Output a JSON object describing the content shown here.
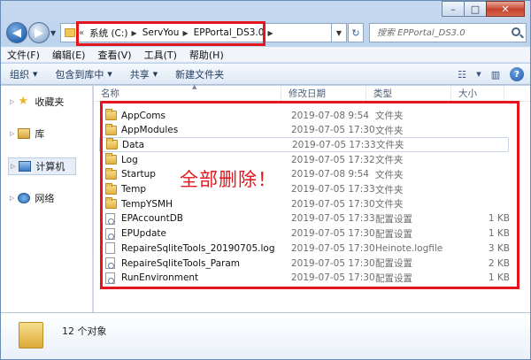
{
  "window": {
    "minimize": "–",
    "maximize": "□",
    "close": "✕"
  },
  "address": {
    "prefix": "«",
    "crumbs": [
      "系统 (C:)",
      "ServYou",
      "EPPortal_DS3.0"
    ]
  },
  "search": {
    "placeholder": "搜索 EPPortal_DS3.0"
  },
  "menu": [
    "文件(F)",
    "编辑(E)",
    "查看(V)",
    "工具(T)",
    "帮助(H)"
  ],
  "toolbar": {
    "organize": "组织",
    "include": "包含到库中",
    "share": "共享",
    "new_folder": "新建文件夹"
  },
  "navpane": {
    "favorites": "收藏夹",
    "libraries": "库",
    "computer": "计算机",
    "network": "网络"
  },
  "columns": {
    "name": "名称",
    "modified": "修改日期",
    "type": "类型",
    "size": "大小"
  },
  "files": [
    {
      "name": "AppComs",
      "date": "2019-07-08 9:54",
      "type": "文件夹",
      "size": "",
      "icon": "folder"
    },
    {
      "name": "AppModules",
      "date": "2019-07-05 17:30",
      "type": "文件夹",
      "size": "",
      "icon": "folder"
    },
    {
      "name": "Data",
      "date": "2019-07-05 17:33",
      "type": "文件夹",
      "size": "",
      "icon": "folder"
    },
    {
      "name": "Log",
      "date": "2019-07-05 17:32",
      "type": "文件夹",
      "size": "",
      "icon": "folder"
    },
    {
      "name": "Startup",
      "date": "2019-07-08 9:54",
      "type": "文件夹",
      "size": "",
      "icon": "folder"
    },
    {
      "name": "Temp",
      "date": "2019-07-05 17:33",
      "type": "文件夹",
      "size": "",
      "icon": "folder"
    },
    {
      "name": "TempYSMH",
      "date": "2019-07-05 17:30",
      "type": "文件夹",
      "size": "",
      "icon": "folder"
    },
    {
      "name": "EPAccountDB",
      "date": "2019-07-05 17:33",
      "type": "配置设置",
      "size": "1 KB",
      "icon": "config"
    },
    {
      "name": "EPUpdate",
      "date": "2019-07-05 17:30",
      "type": "配置设置",
      "size": "1 KB",
      "icon": "config"
    },
    {
      "name": "RepaireSqliteTools_20190705.log",
      "date": "2019-07-05 17:30",
      "type": "Heinote.logfile",
      "size": "3 KB",
      "icon": "text"
    },
    {
      "name": "RepaireSqliteTools_Param",
      "date": "2019-07-05 17:30",
      "type": "配置设置",
      "size": "2 KB",
      "icon": "config"
    },
    {
      "name": "RunEnvironment",
      "date": "2019-07-05 17:30",
      "type": "配置设置",
      "size": "1 KB",
      "icon": "config"
    }
  ],
  "annotation": "全部删除！",
  "status": {
    "count": "12 个对象"
  },
  "colors": {
    "highlight": "#e4151b",
    "accent": "#2a68b0"
  }
}
